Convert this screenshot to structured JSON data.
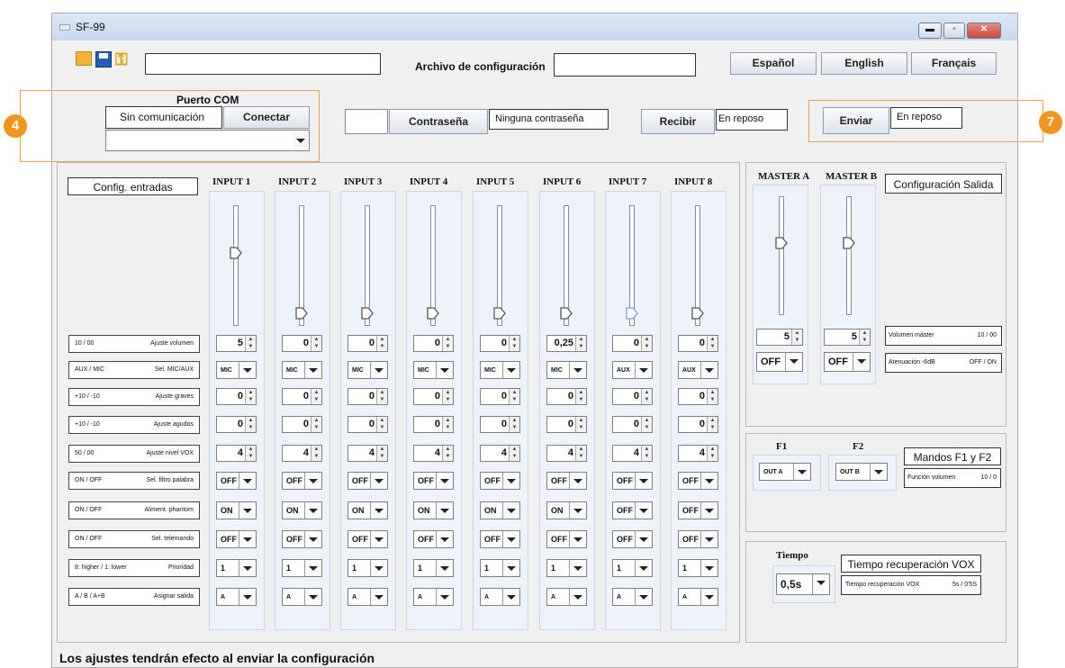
{
  "window": {
    "title": "SF-99"
  },
  "toolbar": {
    "path_value": "",
    "config_label": "Archivo de configuración",
    "config_value": "",
    "lang": [
      "Español",
      "English",
      "Français"
    ]
  },
  "com": {
    "title": "Puerto COM",
    "status": "Sin comunicación",
    "connect": "Conectar",
    "port_value": ""
  },
  "password": {
    "value": "",
    "button": "Contraseña",
    "status": "Ninguna contraseña"
  },
  "receive": {
    "button": "Recibir",
    "status": "En reposo"
  },
  "send": {
    "button": "Enviar",
    "status": "En reposo"
  },
  "badges": {
    "four": "4",
    "seven": "7"
  },
  "inputs": {
    "config_label": "Config. entradas",
    "names": [
      "INPUT 1",
      "INPUT 2",
      "INPUT 3",
      "INPUT 4",
      "INPUT 5",
      "INPUT 6",
      "INPUT 7",
      "INPUT 8"
    ],
    "slider_levels": [
      0.55,
      0.05,
      0.05,
      0.05,
      0.05,
      0.05,
      0.05,
      0.05
    ],
    "volume": [
      "5",
      "0",
      "0",
      "0",
      "0",
      "0,25",
      "0",
      "0"
    ],
    "mic_aux": [
      "MIC",
      "MIC",
      "MIC",
      "MIC",
      "MIC",
      "MIC",
      "AUX",
      "AUX"
    ],
    "bass": [
      "0",
      "0",
      "0",
      "0",
      "0",
      "0",
      "0",
      "0"
    ],
    "treble": [
      "0",
      "0",
      "0",
      "0",
      "0",
      "0",
      "0",
      "0"
    ],
    "vox": [
      "4",
      "4",
      "4",
      "4",
      "4",
      "4",
      "4",
      "4"
    ],
    "word_filter": [
      "OFF",
      "OFF",
      "OFF",
      "OFF",
      "OFF",
      "OFF",
      "OFF",
      "OFF"
    ],
    "phantom": [
      "ON",
      "ON",
      "ON",
      "ON",
      "ON",
      "ON",
      "OFF",
      "OFF"
    ],
    "remote": [
      "OFF",
      "OFF",
      "OFF",
      "OFF",
      "OFF",
      "OFF",
      "OFF",
      "OFF"
    ],
    "priority": [
      "1",
      "1",
      "1",
      "1",
      "1",
      "1",
      "1",
      "1"
    ],
    "output": [
      "A",
      "A",
      "A",
      "A",
      "A",
      "A",
      "A",
      "A"
    ]
  },
  "row_labels": [
    {
      "range": "10 / 00",
      "name": "Ajuste volumen"
    },
    {
      "range": "AUX / MIC",
      "name": "Sel. MIC/AUX"
    },
    {
      "range": "+10 / -10",
      "name": "Ajuste graves"
    },
    {
      "range": "+10 / -10",
      "name": "Ajuste agudos"
    },
    {
      "range": "50 / 00",
      "name": "Ajuste nivel VOX"
    },
    {
      "range": "ON / OFF",
      "name": "Sel. filtro palabra"
    },
    {
      "range": "ON / OFF",
      "name": "Aliment. phantom"
    },
    {
      "range": "ON / OFF",
      "name": "Sel. telemando"
    },
    {
      "range": "8: higher / 1: lower",
      "name": "Prioridad"
    },
    {
      "range": "A / B / A+B",
      "name": "Asignar salida"
    }
  ],
  "master": {
    "names": [
      "MASTER A",
      "MASTER B"
    ],
    "config_label": "Configuración Salida",
    "slider_levels": [
      0.55,
      0.55
    ],
    "volume": [
      "5",
      "5"
    ],
    "atten": [
      "OFF",
      "OFF"
    ],
    "vol_label": "Volumen máster",
    "vol_range": "10 / 00",
    "att_label": "Atenuación -6dB",
    "att_range": "OFF / ON"
  },
  "mandos": {
    "names": [
      "F1",
      "F2"
    ],
    "values": [
      "OUT A",
      "OUT B"
    ],
    "title": "Mandos F1 y F2",
    "func_label": "Función volumen",
    "func_range": "10 / 0"
  },
  "tiempo": {
    "title": "Tiempo",
    "value": "0,5s",
    "label": "Tiempo recuperación VOX",
    "desc": "Tiempo recuperación VOX",
    "desc_range": "5s / 0'5S"
  },
  "footer": "Los ajustes tendrán efecto al enviar la configuración",
  "colors": {
    "accent": "#f0961e",
    "titlebar": "#c9d9ef",
    "close": "#c94b3c"
  }
}
